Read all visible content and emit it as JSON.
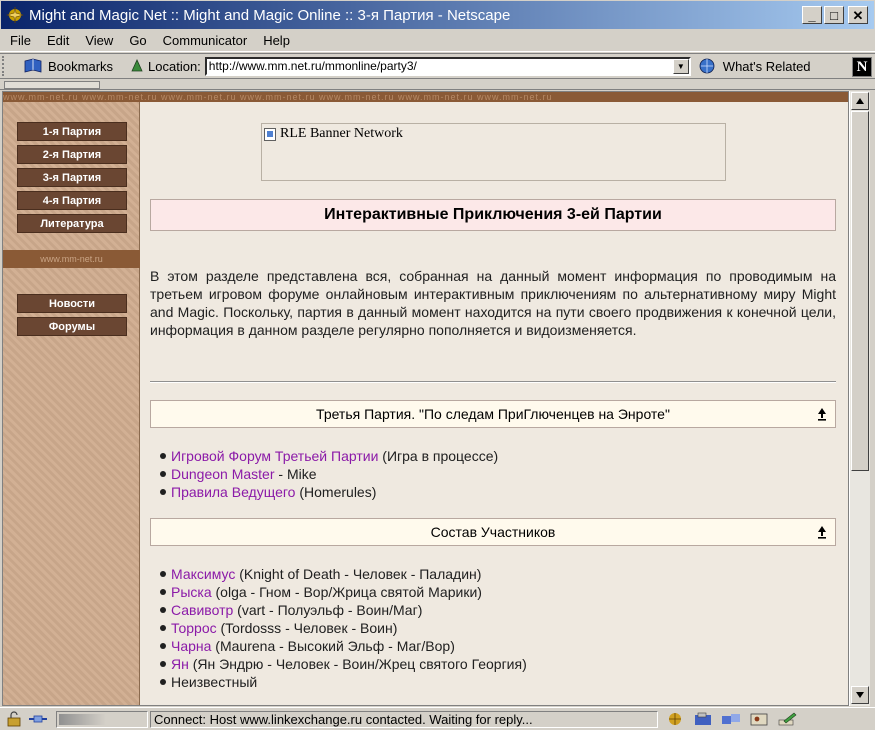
{
  "window": {
    "title": "Might and Magic Net :: Might and Magic Online :: 3-я Партия - Netscape",
    "min_label": "_",
    "max_label": "□",
    "close_label": "✕"
  },
  "menu": [
    "File",
    "Edit",
    "View",
    "Go",
    "Communicator",
    "Help"
  ],
  "toolbar": {
    "bookmarks_label": "Bookmarks",
    "location_label": "Location:",
    "url": "http://www.mm.net.ru/mmonline/party3/",
    "related_label": "What's Related",
    "brand_letter": "N"
  },
  "site": {
    "watermark": "www.mm-net.ru   www.mm-net.ru   www.mm-net.ru   www.mm-net.ru   www.mm-net.ru   www.mm-net.ru   www.mm-net.ru",
    "side_watermark": "www.mm-net.ru",
    "nav": [
      "1-я Партия",
      "2-я Партия",
      "3-я Партия",
      "4-я Партия",
      "Литература"
    ],
    "nav2": [
      "Новости",
      "Форумы"
    ],
    "banner": "RLE Banner Network",
    "page_title": "Интерактивные Приключения 3-ей Партии",
    "intro": "В этом разделе представлена вся, собранная на данный момент информация по проводимым на третьем игровом форуме онлайновым интерактивным приключениям по альтернативному миру Might and Magic. Поскольку, партия в данный момент находится на пути своего продвижения к конечной цели, информация в данном разделе регулярно пополняется и видоизменяется.",
    "section1": {
      "title": "Третья Партия. \"По следам ПриГлюченцев на Энроте\"",
      "items": [
        {
          "link": "Игровой Форум Третьей Партии",
          "rest": " (Игра в процессе)"
        },
        {
          "link": "Dungeon Master",
          "rest": " - Mike"
        },
        {
          "link": "Правила Ведущего",
          "rest": " (Homerules)"
        }
      ]
    },
    "section2": {
      "title": "Состав Участников",
      "items": [
        {
          "link": "Максимус",
          "rest": " (Knight of Death - Человек - Паладин)"
        },
        {
          "link": "Рыска",
          "rest": " (olga - Гном - Вор/Жрица святой Марики)"
        },
        {
          "link": "Савивотр",
          "rest": " (vart - Полуэльф - Воин/Маг)"
        },
        {
          "link": "Торрос",
          "rest": " (Tordosss - Человек - Воин)"
        },
        {
          "link": "Чарна",
          "rest": " (Maurena - Высокий Эльф - Маг/Вор)"
        },
        {
          "link": "Ян",
          "rest": " (Ян Эндрю - Человек - Воин/Жрец святого Георгия)"
        },
        {
          "link": "",
          "rest": "Неизвестный"
        }
      ]
    }
  },
  "status": {
    "text": "Connect: Host www.linkexchange.ru contacted. Waiting for reply...",
    "progress": 0.55
  },
  "colors": {
    "link": "#8b1aa8",
    "nav_button": "#6a4632",
    "title_bar_start": "#0a246a"
  }
}
